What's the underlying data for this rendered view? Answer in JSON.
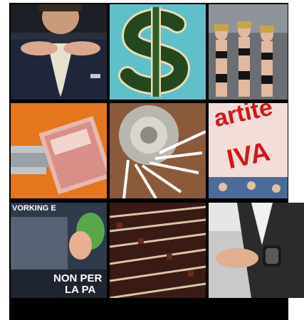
{
  "gallery": {
    "tiles": [
      {
        "subject": "man-suit-hands"
      },
      {
        "subject": "dollar-island"
      },
      {
        "subject": "models-runway"
      },
      {
        "subject": "radiator-money"
      },
      {
        "subject": "spiral-staircase"
      },
      {
        "subject": "partite-iva-sign",
        "text_line1": "artite",
        "text_line2": "IVA"
      },
      {
        "subject": "working-poster",
        "text_top": "VORKING E",
        "text_line1": "NON PER",
        "text_line2": "LA PA"
      },
      {
        "subject": "parliament-seats"
      },
      {
        "subject": "wristwatch"
      }
    ]
  },
  "colors": {
    "frame": "#000000",
    "accent_red": "#d01818",
    "background": "#ffffff"
  }
}
